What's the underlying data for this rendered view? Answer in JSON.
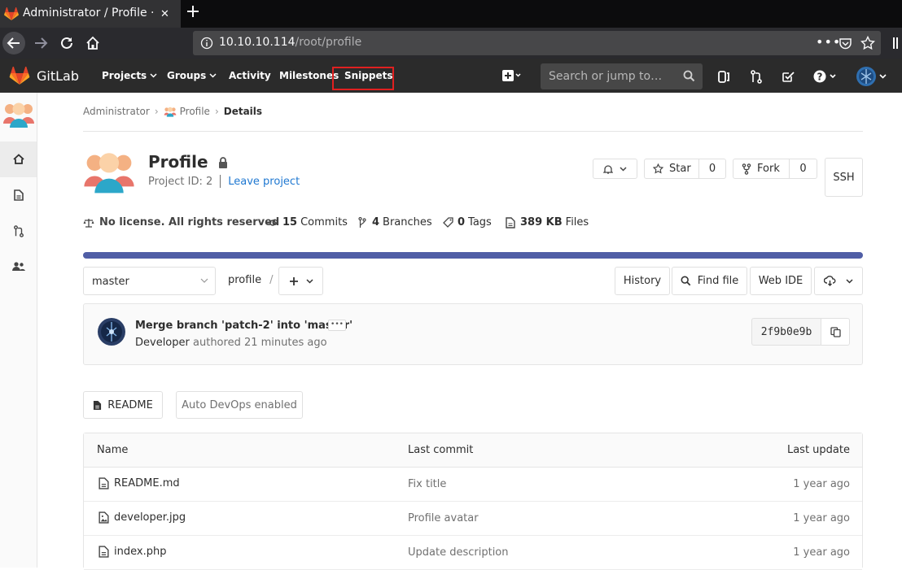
{
  "browser": {
    "tab_title": "Administrator / Profile · G",
    "url_host": "10.10.10.114",
    "url_path": "/root/profile"
  },
  "gitlab": {
    "brand": "GitLab",
    "nav": {
      "projects": "Projects",
      "groups": "Groups",
      "activity": "Activity",
      "milestones": "Milestones",
      "snippets": "Snippets"
    },
    "search_placeholder": "Search or jump to…",
    "accent_orange": "#e24329",
    "highlight_color": "#e02020"
  },
  "breadcrumb": {
    "root": "Administrator",
    "project": "Profile",
    "current": "Details"
  },
  "project": {
    "name": "Profile",
    "id_label": "Project ID: 2",
    "leave": "Leave project",
    "star_label": "Star",
    "star_count": "0",
    "fork_label": "Fork",
    "fork_count": "0",
    "ssh_label": "SSH"
  },
  "stats": {
    "license": "No license. All rights reserved",
    "commits_n": "15",
    "commits_l": "Commits",
    "branches_n": "4",
    "branches_l": "Branches",
    "tags_n": "0",
    "tags_l": "Tags",
    "files_n": "389 KB",
    "files_l": "Files"
  },
  "repo": {
    "branch": "master",
    "path": "profile",
    "path_sep": "/",
    "history": "History",
    "find_file": "Find file",
    "web_ide": "Web IDE"
  },
  "last_commit": {
    "message": "Merge branch 'patch-2' into 'master'",
    "author": "Developer",
    "authored": "authored 21 minutes ago",
    "sha": "2f9b0e9b"
  },
  "buttons": {
    "readme": "README",
    "autodevops": "Auto DevOps enabled"
  },
  "files": {
    "headers": {
      "name": "Name",
      "last_commit": "Last commit",
      "last_update": "Last update"
    },
    "rows": [
      {
        "name": "README.md",
        "commit": "Fix title",
        "updated": "1 year ago",
        "icon": "file-text-icon"
      },
      {
        "name": "developer.jpg",
        "commit": "Profile avatar",
        "updated": "1 year ago",
        "icon": "file-image-icon"
      },
      {
        "name": "index.php",
        "commit": "Update description",
        "updated": "1 year ago",
        "icon": "file-text-icon"
      }
    ]
  }
}
